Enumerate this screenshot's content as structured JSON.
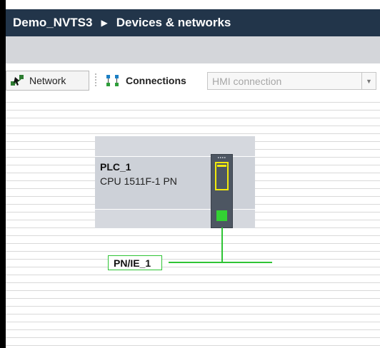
{
  "breadcrumb": {
    "project": "Demo_NVTS3",
    "separator": "▶",
    "page": "Devices & networks"
  },
  "toolbar": {
    "network_label": "Network",
    "connections_label": "Connections",
    "connection_type_value": "HMI connection"
  },
  "device": {
    "name": "PLC_1",
    "type": "CPU 1511F-1 PN"
  },
  "subnet": {
    "name": "PN/IE_1"
  },
  "colors": {
    "title_bar": "#22354a",
    "network_line": "#2fc435",
    "display_yellow": "#f2ea0c",
    "port_green": "#33d133"
  }
}
